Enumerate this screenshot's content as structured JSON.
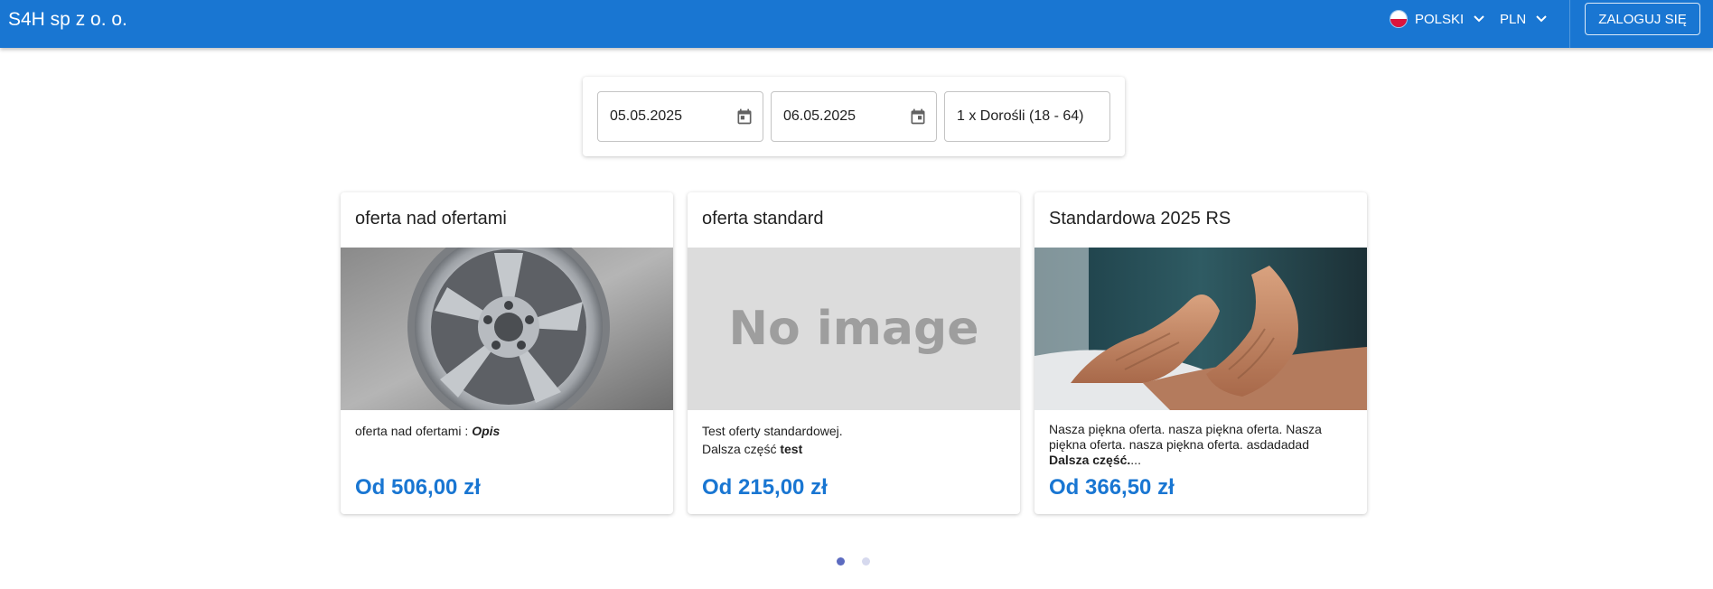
{
  "header": {
    "brand": "S4H sp z o. o.",
    "language": "POLSKI",
    "currency": "PLN",
    "login_label": "ZALOGUJ SIĘ",
    "accent_color": "#1976d2"
  },
  "search": {
    "date_from": "05.05.2025",
    "date_to": "06.05.2025",
    "guests": "1 x Dorośli (18 - 64)"
  },
  "offers": [
    {
      "title": "oferta nad ofertami",
      "image": "alloy-wheel-photo",
      "desc_text": "oferta nad ofertami : ",
      "desc_emph": "Opis",
      "price": "Od 506,00 zł"
    },
    {
      "title": "oferta standard",
      "image": "no-image-placeholder",
      "image_text": "No image",
      "desc_line1": "Test oferty standardowej.",
      "desc_line2_text": "Dalsza część ",
      "desc_line2_bold": "test",
      "price": "Od 215,00 zł"
    },
    {
      "title": "Standardowa 2025 RS",
      "image": "massage-photo",
      "desc_line1": "Nasza piękna oferta. nasza piękna oferta. Nasza piękna oferta. nasza piękna oferta. asdadadad",
      "desc_line2_bold": "Dalsza część.",
      "desc_line2_text": "...",
      "price": "Od 366,50 zł"
    }
  ],
  "pagination": {
    "pages": 2,
    "active": 1
  }
}
